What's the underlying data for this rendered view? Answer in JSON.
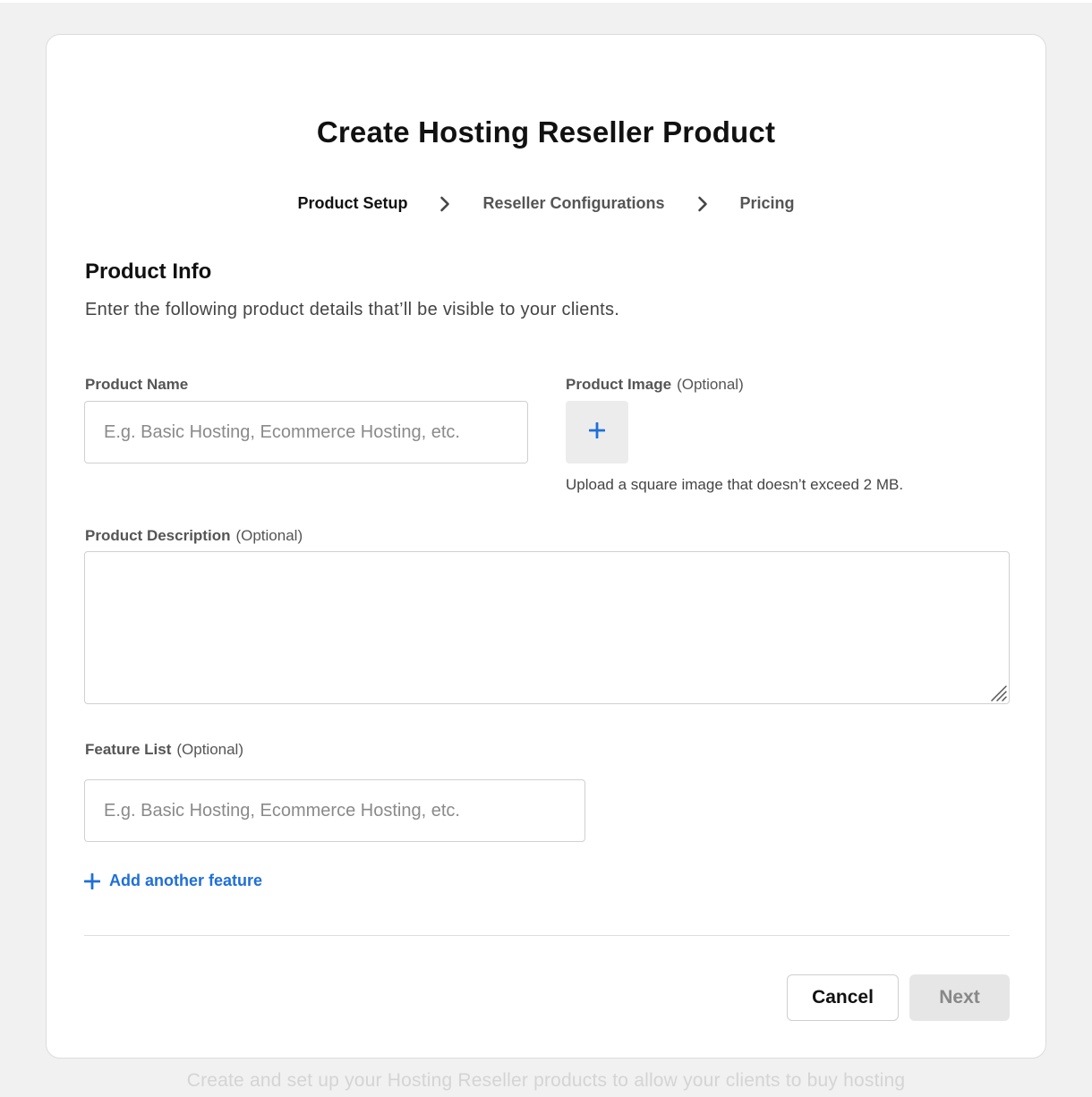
{
  "page": {
    "title": "Create Hosting Reseller Product",
    "background_caption": "Create and set up your Hosting Reseller products to allow your clients to buy hosting"
  },
  "stepper": {
    "steps": [
      {
        "label": "Product Setup",
        "active": true
      },
      {
        "label": "Reseller Configurations",
        "active": false
      },
      {
        "label": "Pricing",
        "active": false
      }
    ]
  },
  "section": {
    "title": "Product Info",
    "subtitle": "Enter the following product details that’ll be visible to your clients."
  },
  "form": {
    "product_name": {
      "label": "Product Name",
      "placeholder": "E.g. Basic Hosting, Ecommerce Hosting, etc.",
      "value": ""
    },
    "product_image": {
      "label": "Product Image",
      "optional": "(Optional)",
      "helper": "Upload a square image that doesn’t exceed 2 MB.",
      "upload_icon": "plus-icon"
    },
    "product_description": {
      "label": "Product Description",
      "optional": "(Optional)",
      "value": ""
    },
    "feature_list": {
      "label": "Feature List",
      "optional": "(Optional)",
      "placeholder": "E.g. Basic Hosting, Ecommerce Hosting, etc.",
      "value": "",
      "add_label": "Add another feature"
    }
  },
  "actions": {
    "cancel_label": "Cancel",
    "next_label": "Next"
  },
  "colors": {
    "accent": "#1f6fd8",
    "disabled_bg": "#e6e6e6",
    "disabled_text": "#888888",
    "page_bg": "#f1f1f1"
  }
}
